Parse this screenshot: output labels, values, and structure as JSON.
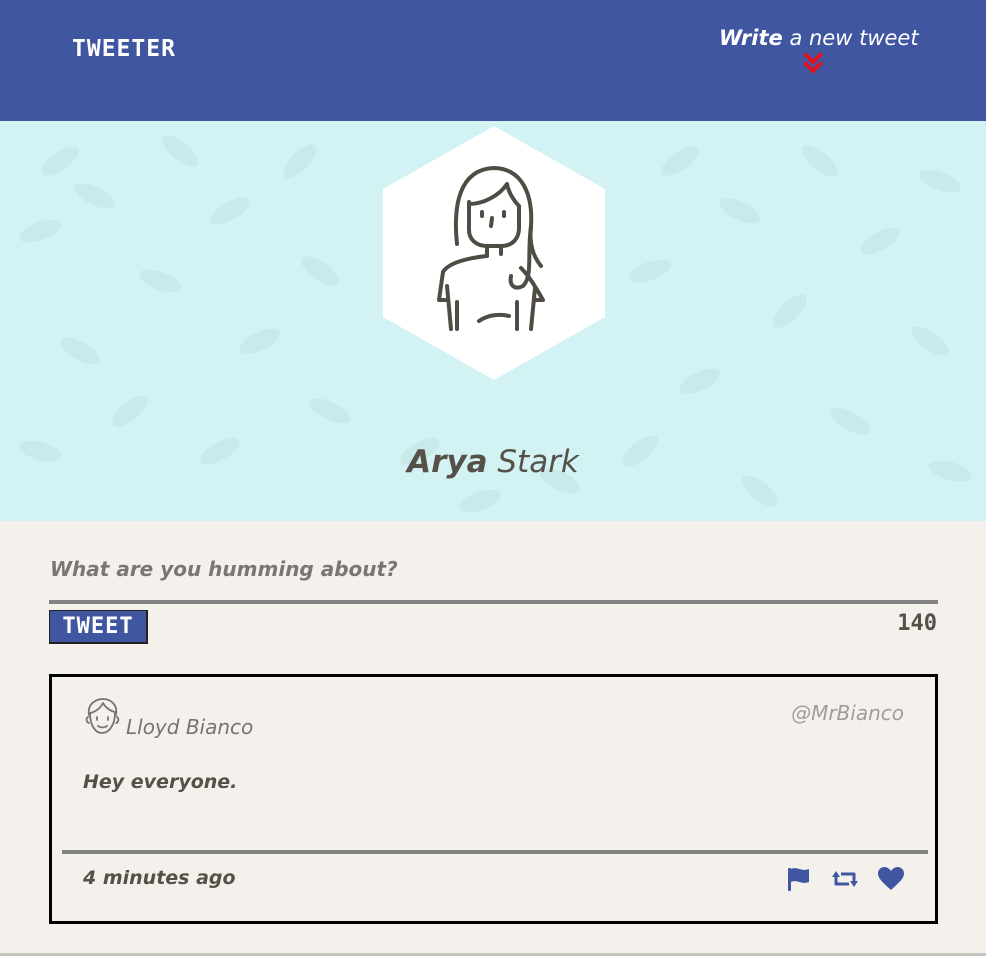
{
  "nav": {
    "brand": "TWEETER",
    "compose_bold": "Write",
    "compose_rest": " a new tweet",
    "chevron_icon": "double-chevron-down-icon",
    "chevron_color": "#e0141e",
    "background": "#4056a1"
  },
  "profile": {
    "first_name": "Arya",
    "last_name": "Stark",
    "avatar_icon": "girl-avatar-icon",
    "background": "#d3f2f3"
  },
  "new_tweet": {
    "placeholder": "What are you humming about?",
    "value": "",
    "button_label": "TWEET",
    "char_counter": "140"
  },
  "tweets": [
    {
      "name": "Lloyd Bianco",
      "handle": "@MrBianco",
      "content": "Hey everyone.",
      "time_ago": "4 minutes ago",
      "avatar_icon": "boy-avatar-icon",
      "actions": [
        "flag-icon",
        "retweet-icon",
        "heart-icon"
      ]
    }
  ],
  "colors": {
    "accent": "#4056a1",
    "page_bg": "#f4f1ec",
    "text": "#555149"
  }
}
